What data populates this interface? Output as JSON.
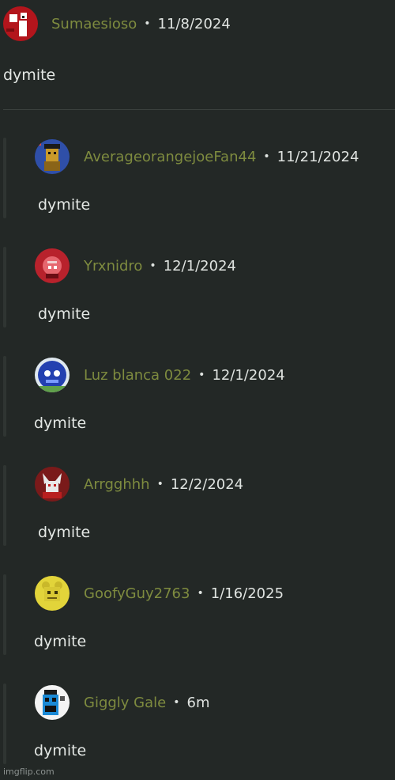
{
  "main_comment": {
    "username": "Sumaesioso",
    "separator": "•",
    "date": "11/8/2024",
    "text": "dymite",
    "avatar_icon": "pixel-character-avatar",
    "avatar_colors": {
      "bg": "#b3151c",
      "fg": "#ffffff"
    }
  },
  "replies": [
    {
      "username": "AverageorangejoeFan44",
      "separator": "•",
      "date": "11/21/2024",
      "text": "dymite",
      "avatar_icon": "animatronic-bear-avatar",
      "avatar_colors": {
        "bg": "#2f4fa8",
        "fg": "#c99a2a"
      }
    },
    {
      "username": "Yrxnidro",
      "separator": "•",
      "date": "12/1/2024",
      "text": "dymite",
      "avatar_icon": "red-character-avatar",
      "avatar_colors": {
        "bg": "#b8222c",
        "fg": "#f0d0d0"
      }
    },
    {
      "username": "Luz blanca 022",
      "separator": "•",
      "date": "12/1/2024",
      "text": "dymite",
      "avatar_icon": "blue-character-avatar",
      "avatar_colors": {
        "bg": "#2340b0",
        "fg": "#f2f2f2"
      }
    },
    {
      "username": "Arrgghhh",
      "separator": "•",
      "date": "12/2/2024",
      "text": "dymite",
      "avatar_icon": "fox-character-avatar",
      "avatar_colors": {
        "bg": "#7a1a1a",
        "fg": "#e8e8e8"
      }
    },
    {
      "username": "GoofyGuy2763",
      "separator": "•",
      "date": "1/16/2025",
      "text": "dymite",
      "avatar_icon": "yellow-bear-avatar",
      "avatar_colors": {
        "bg": "#e2d43a",
        "fg": "#6b5a10"
      }
    },
    {
      "username": "Giggly Gale",
      "separator": "•",
      "date": "6m",
      "text": "dymite",
      "avatar_icon": "pixel-robot-avatar",
      "avatar_colors": {
        "bg": "#f4f4f4",
        "fg": "#1b8ad6"
      }
    }
  ],
  "watermark": "imgflip.com",
  "colors": {
    "background": "#232826",
    "username": "#7e8b3f",
    "text": "#dfe3e0"
  }
}
